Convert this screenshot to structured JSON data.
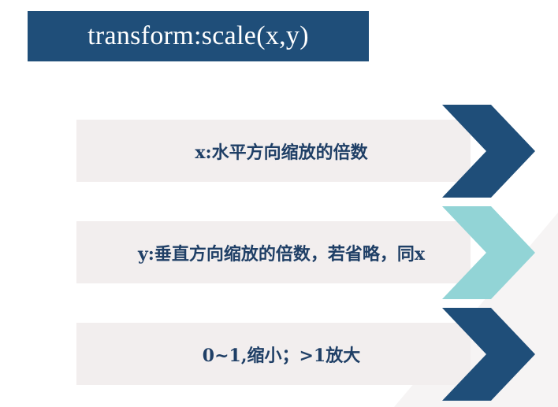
{
  "title": "transform:scale(x,y)",
  "items": [
    {
      "label": "x:水平方向缩放的倍数",
      "chevron_color": "#1f4e79"
    },
    {
      "label": "y:垂直方向缩放的倍数，若省略，同x",
      "chevron_color": "#92d4d6"
    },
    {
      "label": "0~1,缩小；>1放大",
      "chevron_color": "#1f4e79"
    }
  ],
  "colors": {
    "title_bg": "#1f4e79",
    "box_bg": "#f2eeee",
    "text": "#1f3f66"
  }
}
